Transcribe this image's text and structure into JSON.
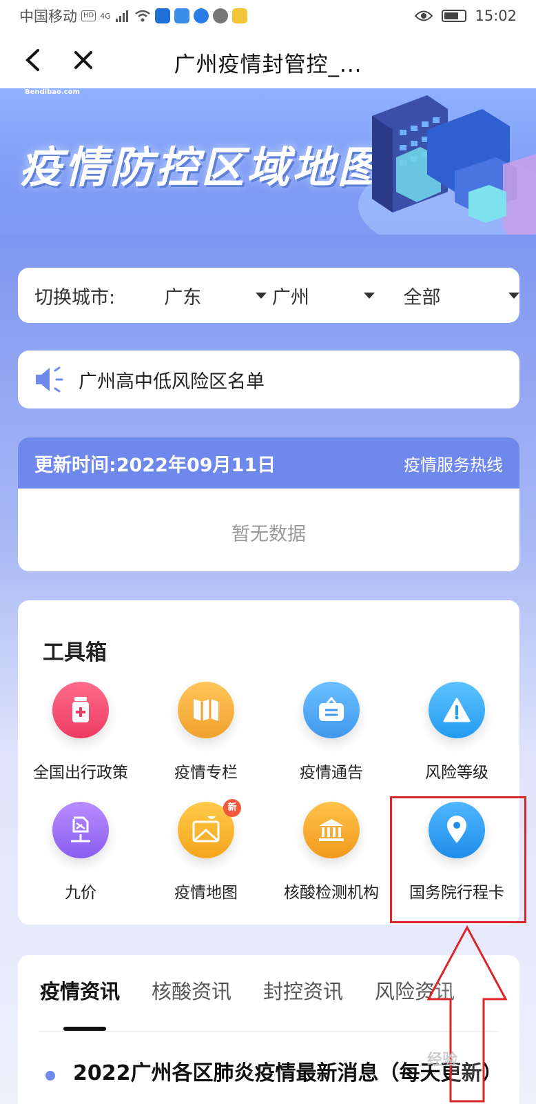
{
  "status_bar": {
    "carrier": "中国移动",
    "hd_badge": "HD",
    "network": "4G",
    "time": "15:02"
  },
  "navbar": {
    "title": "广州疫情封管控_..."
  },
  "banner": {
    "site": "Bendibao.com",
    "title": "疫情防控区域地图"
  },
  "city_selector": {
    "label": "切换城市:",
    "province": "广东",
    "city": "广州",
    "district": "全部"
  },
  "notice": {
    "text": "广州高中低风险区名单"
  },
  "update": {
    "label": "更新时间:",
    "date": "2022年09月11日",
    "hotline": "疫情服务热线",
    "empty_text": "暂无数据"
  },
  "toolbox": {
    "title": "工具箱",
    "items": [
      {
        "label": "全国出行政策",
        "icon": "medicine-bottle-icon",
        "color": "#f2456c"
      },
      {
        "label": "疫情专栏",
        "icon": "map-book-icon",
        "color": "#f3b040"
      },
      {
        "label": "疫情通告",
        "icon": "notice-board-icon",
        "color": "#4aa8f3"
      },
      {
        "label": "风险等级",
        "icon": "warning-icon",
        "color": "#39a8f2"
      },
      {
        "label": "九价",
        "icon": "vaccine-icon",
        "color": "#9b6cf0"
      },
      {
        "label": "疫情地图",
        "icon": "map-pin-icon",
        "color": "#f6b22c",
        "badge": "新"
      },
      {
        "label": "核酸检测机构",
        "icon": "institution-icon",
        "color": "#f5a623"
      },
      {
        "label": "国务院行程卡",
        "icon": "location-pin-icon",
        "color": "#2b9bf0"
      }
    ]
  },
  "news": {
    "tabs": [
      "疫情资讯",
      "核酸资讯",
      "封控资讯",
      "风险资讯"
    ],
    "headline": "2022广州各区肺炎疫情最新消息（每天更新）"
  },
  "colors": {
    "accent": "#6f88ec",
    "highlight": "#d9262b"
  }
}
